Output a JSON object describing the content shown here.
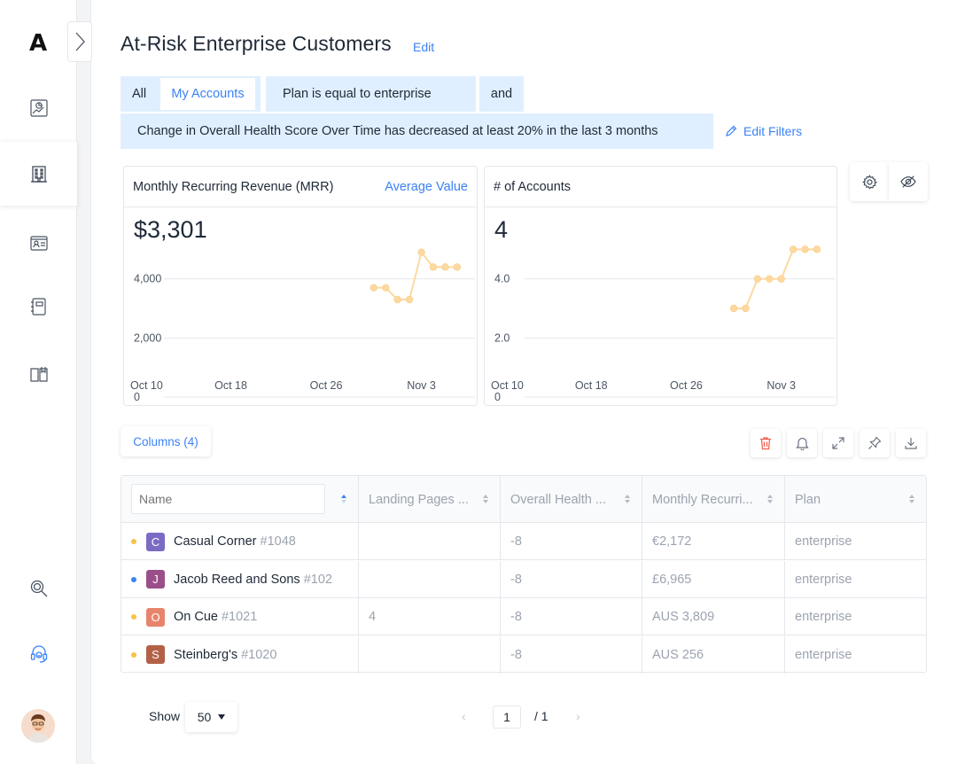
{
  "page": {
    "title": "At-Risk Enterprise Customers",
    "edit_label": "Edit"
  },
  "filters": {
    "all_label": "All",
    "my_accounts_label": "My Accounts",
    "plan_condition": "Plan is equal to enterprise",
    "conjunction": "and",
    "health_condition": "Change in Overall Health Score Over Time has decreased at least 20% in the last 3 months",
    "edit_filters_label": "Edit Filters"
  },
  "sidebar": {
    "logo_letter": "A",
    "items": [
      {
        "icon": "report-icon"
      },
      {
        "icon": "building-icon",
        "active": true
      },
      {
        "icon": "contact-card-icon"
      },
      {
        "icon": "notebook-icon"
      },
      {
        "icon": "book-icon"
      },
      {
        "icon": "search-icon"
      },
      {
        "icon": "support-headset-icon"
      }
    ]
  },
  "panels": {
    "mrr": {
      "title": "Monthly Recurring Revenue (MRR)",
      "link": "Average Value",
      "value": "$3,301"
    },
    "accounts": {
      "title": "# of Accounts",
      "value": "4"
    }
  },
  "chart_data": [
    {
      "type": "line",
      "title": "Monthly Recurring Revenue (MRR)",
      "x": [
        "Oct 30",
        "Oct 31",
        "Nov 1",
        "Nov 2",
        "Nov 3",
        "Nov 4",
        "Nov 5",
        "Nov 6"
      ],
      "values": [
        3700,
        3700,
        3300,
        3300,
        4900,
        4400,
        4400,
        4400
      ],
      "x_ticks": [
        "Oct 10",
        "Oct 18",
        "Oct 26",
        "Nov 3"
      ],
      "y_ticks": [
        "0",
        "2,000",
        "4,000"
      ],
      "ylim": [
        0,
        6000
      ],
      "xlim_days": [
        0,
        30
      ],
      "color": "#fcd9a2"
    },
    {
      "type": "line",
      "title": "# of Accounts",
      "x": [
        "Oct 30",
        "Oct 31",
        "Nov 1",
        "Nov 2",
        "Nov 3",
        "Nov 4",
        "Nov 5",
        "Nov 6"
      ],
      "values": [
        3.0,
        3.0,
        4.0,
        4.0,
        4.0,
        5.0,
        5.0,
        5.0
      ],
      "x_ticks": [
        "Oct 10",
        "Oct 18",
        "Oct 26",
        "Nov 3"
      ],
      "y_ticks": [
        "0",
        "2.0",
        "4.0"
      ],
      "ylim": [
        0,
        6
      ],
      "color": "#fcd9a2"
    }
  ],
  "toolbar": {
    "columns_label": "Columns (4)"
  },
  "table": {
    "name_placeholder": "Name",
    "headers": [
      "Landing Pages ...",
      "Overall Health ...",
      "Monthly Recurri...",
      "Plan"
    ],
    "rows": [
      {
        "letter": "C",
        "badge_color": "#7c6bc4",
        "dot_color": "#f6c344",
        "name": "Casual Corner",
        "id": "#1048",
        "landing": "",
        "health": "-8",
        "mrr": "€2,172",
        "plan": "enterprise"
      },
      {
        "letter": "J",
        "badge_color": "#9a4f8a",
        "dot_color": "#3b82f6",
        "name": "Jacob Reed and Sons",
        "id": "#102",
        "landing": "",
        "health": "-8",
        "mrr": "£6,965",
        "plan": "enterprise"
      },
      {
        "letter": "O",
        "badge_color": "#e8846b",
        "dot_color": "#f6c344",
        "name": "On Cue",
        "id": "#1021",
        "landing": "4",
        "health": "-8",
        "mrr": "AUS 3,809",
        "plan": "enterprise"
      },
      {
        "letter": "S",
        "badge_color": "#b36146",
        "dot_color": "#f6c344",
        "name": "Steinberg's",
        "id": "#1020",
        "landing": "",
        "health": "-8",
        "mrr": "AUS 256",
        "plan": "enterprise"
      }
    ]
  },
  "pagination": {
    "show_label": "Show",
    "page_size": "50",
    "prev": "‹",
    "current": "1",
    "total": "/ 1",
    "next": "›"
  }
}
